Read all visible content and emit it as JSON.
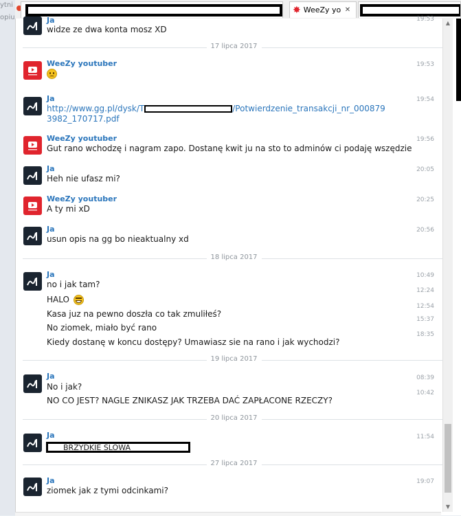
{
  "background": {
    "left_texts": [
      "ytni",
      "opiu"
    ]
  },
  "tabs": [
    {
      "label": "",
      "redacted": true
    },
    {
      "label": "WeeZy yout",
      "active": true
    },
    {
      "label": "",
      "redacted": true
    }
  ],
  "tab_close_glyph": "✕",
  "colors": {
    "sender": "#2a75bb",
    "youtube_red": "#e0242d",
    "ja_avatar": "#1a2430"
  },
  "messages": [
    {
      "sender": "Ja",
      "text": "widze ze dwa konta mosz XD",
      "time": "19:53"
    },
    {
      "date": "17 lipca 2017"
    },
    {
      "sender": "WeeZy youtuber",
      "emoji": "sad-face",
      "time": "19:53"
    },
    {
      "sender": "Ja",
      "link_prefix": "http://www.gg.pl/dysk/T",
      "link_suffix": "/Potwierdzenie_transakcji_nr_000879",
      "link_line2": "3982_170717.pdf",
      "time": "19:54"
    },
    {
      "sender": "WeeZy youtuber",
      "text": "Gut rano wchodzę i nagram zapo. Dostanę kwit ju na sto to adminów ci podaję wszędzie",
      "time": "19:56"
    },
    {
      "sender": "Ja",
      "text": "Heh nie ufasz mi?",
      "time": "20:05"
    },
    {
      "sender": "WeeZy youtuber",
      "text": "A ty mi xD",
      "time": "20:25"
    },
    {
      "sender": "Ja",
      "text": "usun opis na gg bo nieaktualny xd",
      "time": "20:56"
    },
    {
      "date": "18 lipca 2017"
    },
    {
      "sender": "Ja",
      "lines": [
        {
          "text": "no i jak tam?",
          "time": "10:49"
        },
        {
          "text": "HALO",
          "emoji": "grin-face",
          "time": "12:24"
        },
        {
          "text": "Kasa juz na pewno doszła co tak zmuliłeś?",
          "time": "12:54"
        },
        {
          "text": "No ziomek, miało być rano",
          "time": "15:37"
        },
        {
          "text": "Kiedy dostanę w koncu dostępy? Umawiasz sie na rano i jak wychodzi?",
          "time": "18:35"
        }
      ]
    },
    {
      "date": "19 lipca 2017"
    },
    {
      "sender": "Ja",
      "lines": [
        {
          "text": "No i jak?",
          "time": "08:39"
        },
        {
          "text": "NO CO JEST? NAGLE ZNIKASZ JAK TRZEBA DAĆ ZAPŁACONE RZECZY?",
          "time": "10:42"
        }
      ]
    },
    {
      "date": "20 lipca 2017"
    },
    {
      "sender": "Ja",
      "text": "BRZYDKIE SLOWA",
      "redacted_box": true,
      "time": "11:54"
    },
    {
      "date": "27 lipca 2017"
    },
    {
      "sender": "Ja",
      "text": "ziomek jak z tymi odcinkami?",
      "time": "19:07"
    }
  ]
}
